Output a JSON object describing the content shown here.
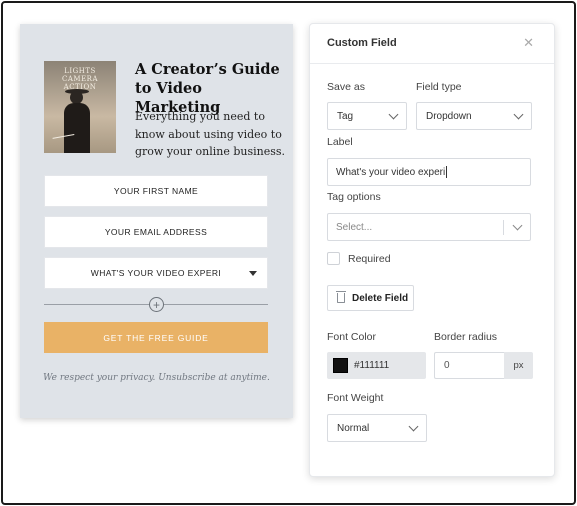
{
  "preview": {
    "book": {
      "cover_title": "LIGHTS CAMERA ACTION"
    },
    "headline": "A Creator’s Guide to Video Marketing",
    "blurb": "Everything you need to know about using video to grow your online business.",
    "fields": [
      {
        "label": "YOUR FIRST NAME"
      },
      {
        "label": "YOUR EMAIL ADDRESS"
      },
      {
        "label": "WHAT'S YOUR VIDEO EXPERI"
      }
    ],
    "add_field_icon": "plus-circle-icon",
    "cta_label": "GET THE FREE GUIDE",
    "privacy": "We respect your privacy. Unsubscribe at anytime."
  },
  "panel": {
    "title": "Custom Field",
    "close_icon": "close-icon",
    "save_as": {
      "label": "Save as",
      "value": "Tag"
    },
    "field_type": {
      "label": "Field type",
      "value": "Dropdown"
    },
    "label_field": {
      "label": "Label",
      "value": "What's your video experi"
    },
    "tag_options": {
      "label": "Tag options",
      "placeholder": "Select..."
    },
    "required": {
      "label": "Required",
      "checked": false
    },
    "delete_button": {
      "label": "Delete Field",
      "icon": "trash-icon"
    },
    "font_color": {
      "label": "Font Color",
      "value": "#111111"
    },
    "border_radius": {
      "label": "Border radius",
      "value": "0",
      "unit": "px"
    },
    "font_weight": {
      "label": "Font Weight",
      "value": "Normal"
    }
  },
  "colors": {
    "cta": "#e9b266",
    "preview_bg": "#dfe3e8",
    "font_color_swatch": "#111111"
  }
}
